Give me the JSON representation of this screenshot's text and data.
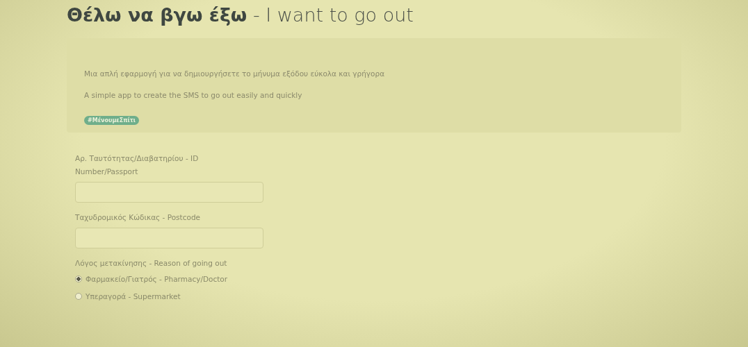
{
  "title": "**Θέλω να βγω έξω** - I want to go out",
  "intro": {
    "lines": [
      "Μια απλή εφαρμογή για να δημιουργήσετε το μήνυμα εξόδου εύκολα και γρήγορα",
      "A simple app to create the SMS to go out easily and quickly"
    ],
    "badge": "#ΜένουμεΣπίτι"
  },
  "fields": [
    {
      "label": "Αρ. Ταυτότητας/Διαβατηρίου - ID Number/Passport"
    },
    {
      "label": "Ταχυδρομικός Κώδικας - Postcode"
    }
  ],
  "reason": {
    "label": "Λόγος μετακίνησης - Reason of going out",
    "options": [
      {
        "label": "Φαρμακείο/Γιατρός - Pharmacy/Doctor",
        "selected": true
      },
      {
        "label": "Υπεραγορά - Supermarket",
        "selected": false
      }
    ]
  }
}
